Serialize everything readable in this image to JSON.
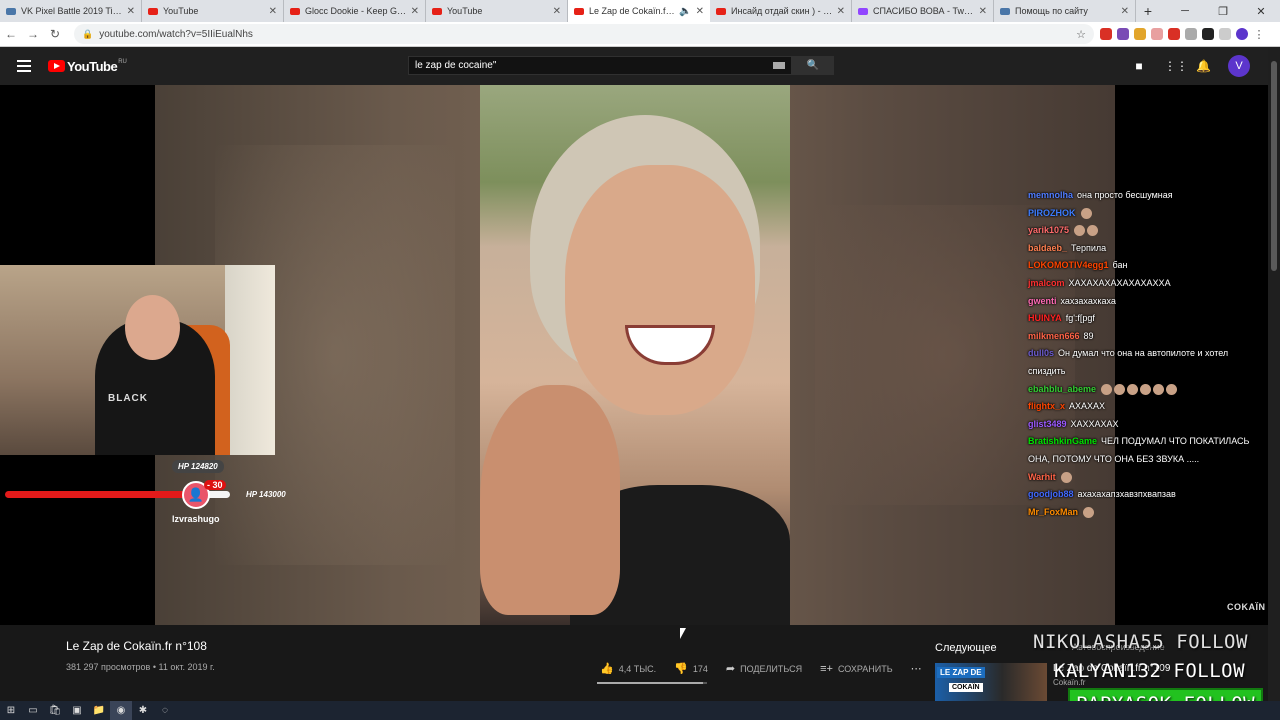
{
  "browser": {
    "tabs": [
      {
        "label": "VK Pixel Battle 2019 Timela",
        "icon": "vk-fav"
      },
      {
        "label": "YouTube",
        "icon": "youtube-fav"
      },
      {
        "label": "Glocc Dookie - Keep Going",
        "icon": "youtube-fav"
      },
      {
        "label": "YouTube",
        "icon": "youtube-fav"
      },
      {
        "label": "Le Zap de Cokaïn.fr n°1",
        "icon": "youtube-fav",
        "active": true
      },
      {
        "label": "Инсайд отдай скин ) - You",
        "icon": "youtube-fav"
      },
      {
        "label": "СПАСИБО ВОВА - Twitch",
        "icon": "twitch-fav"
      },
      {
        "label": "Помощь по сайту",
        "icon": "vk-fav"
      }
    ],
    "url": "youtube.com/watch?v=5IIiEualNhs"
  },
  "youtube": {
    "logo_text": "YouTube",
    "region": "RU",
    "search_query": "le zap de cocaine\"",
    "avatar_letter": "V"
  },
  "video": {
    "title": "Le Zap de Cokaïn.fr n°108",
    "meta": "381 297 просмотров • 11 окт. 2019 г.",
    "likes": "4,4 ТЫС.",
    "dislikes": "174",
    "share_label": "ПОДЕЛИТЬСЯ",
    "save_label": "СОХРАНИТЬ",
    "like_ratio": 0.96,
    "watermark": "COKAÏN"
  },
  "up_next": {
    "label": "Следующее",
    "autoplay_label": "Автовоспроизведение",
    "title": "Le Zap de Cokaïn.fr n°109",
    "channel": "Cokaïn.fr",
    "views": "1,4",
    "thumb_text1": "LE ZAP DE",
    "thumb_text2": "COKAÏN"
  },
  "stream_overlay": {
    "webcam_shirt": "BLACK",
    "hp_top": "HP 124820",
    "hp_damage": "- 30",
    "hp_right": "HP 143000",
    "hp_name": "lzvrashugo",
    "hp_fill": 0.87
  },
  "chat": [
    {
      "user": "memnolha",
      "color": "#4f7cff",
      "text": "она просто бесшумная"
    },
    {
      "user": "PIROZHOK",
      "color": "#3d7dff",
      "text": "",
      "emotes": 1
    },
    {
      "user": "yarik1075",
      "color": "#ff6b6b",
      "text": "",
      "emotes": 2
    },
    {
      "user": "baldaeb_",
      "color": "#ff7f50",
      "text": "Терпила"
    },
    {
      "user": "LOKOMOTIV4egg1",
      "color": "#ff4500",
      "text": "бан"
    },
    {
      "user": "jmalcom",
      "color": "#ff3030",
      "text": "ХАХАХАХАХАХАХАХХА"
    },
    {
      "user": "gwenti",
      "color": "#ff69b4",
      "text": "хахзахахкаха"
    },
    {
      "user": "HUINYA",
      "color": "#ff2222",
      "text": "fg':f[pgf"
    },
    {
      "user": "milkmen666",
      "color": "#ff6347",
      "text": "89"
    },
    {
      "user": "dull0s",
      "color": "#6a5acd",
      "text": "Он думал что она на автопилоте и хотел спиздить"
    },
    {
      "user": "ebahblu_abeme",
      "color": "#32cd32",
      "text": "",
      "emotes": 6
    },
    {
      "user": "flightx_x",
      "color": "#ff4500",
      "text": "АХАХАХ"
    },
    {
      "user": "glist3489",
      "color": "#9b59ff",
      "text": "ХАХХАХАХ"
    },
    {
      "user": "BratishkinGame",
      "color": "#00e000",
      "text": "ЧЕЛ ПОДУМАЛ ЧТО ПОКАТИЛАСЬ ОНА, ПОТОМУ ЧТО ОНА БЕЗ ЗВУКА ....."
    },
    {
      "user": "Warhit",
      "color": "#ff6347",
      "text": "",
      "emotes": 1
    },
    {
      "user": "goodjob88",
      "color": "#4169ff",
      "text": "ахахахапзхавзпхвапзав"
    },
    {
      "user": "Mr_FoxMan",
      "color": "#ff8c00",
      "text": "",
      "emotes": 1
    }
  ],
  "follows": [
    "NIKOLASHA55 FOLLOW",
    "KALYAN132 FOLLOW",
    "PAPYASOK FOLLOW"
  ]
}
